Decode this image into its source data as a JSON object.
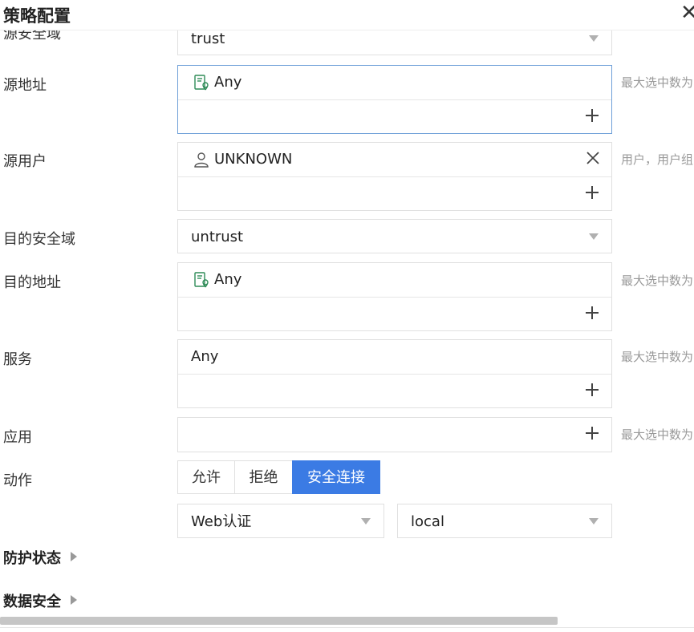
{
  "dialog": {
    "title": "策略配置"
  },
  "fields": {
    "src_zone": {
      "label": "源安全域",
      "value": "trust"
    },
    "src_addr": {
      "label": "源地址",
      "value": "Any",
      "hint": "最大选中数为"
    },
    "src_user": {
      "label": "源用户",
      "value": "UNKNOWN",
      "hint": "用户，用户组"
    },
    "dst_zone": {
      "label": "目的安全域",
      "value": "untrust"
    },
    "dst_addr": {
      "label": "目的地址",
      "value": "Any",
      "hint": "最大选中数为"
    },
    "service": {
      "label": "服务",
      "value": "Any",
      "hint": "最大选中数为"
    },
    "app": {
      "label": "应用",
      "hint": "最大选中数为"
    },
    "action": {
      "label": "动作",
      "options": [
        "允许",
        "拒绝",
        "安全连接"
      ],
      "selected": "安全连接",
      "auth_method": "Web认证",
      "auth_server": "local"
    }
  },
  "sections": [
    {
      "label": "防护状态"
    },
    {
      "label": "数据安全"
    }
  ],
  "icons": {
    "address": "address-book-icon",
    "user": "user-icon",
    "add": "plus-icon",
    "remove": "close-icon"
  },
  "colors": {
    "accent": "#3b7be4",
    "icon_green": "#2e8b57"
  }
}
